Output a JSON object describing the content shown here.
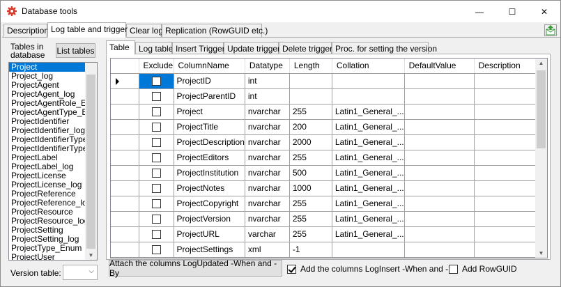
{
  "window": {
    "title": "Database tools",
    "controls": {
      "minimize": "—",
      "maximize": "☐",
      "close": "✕"
    }
  },
  "tabs": [
    {
      "label": "Description"
    },
    {
      "label": "Log table and trigger"
    },
    {
      "label": "Clear log"
    },
    {
      "label": "Replication (RowGUID etc.)"
    }
  ],
  "left": {
    "tables_label": "Tables in database",
    "list_tables_button": "List tables",
    "tables": [
      "Project",
      "Project_log",
      "ProjectAgent",
      "ProjectAgent_log",
      "ProjectAgentRole_Enum",
      "ProjectAgentType_Enum",
      "ProjectIdentifier",
      "ProjectIdentifier_log",
      "ProjectIdentifierType",
      "ProjectIdentifierType_log",
      "ProjectLabel",
      "ProjectLabel_log",
      "ProjectLicense",
      "ProjectLicense_log",
      "ProjectReference",
      "ProjectReference_log",
      "ProjectResource",
      "ProjectResource_log",
      "ProjectSetting",
      "ProjectSetting_log",
      "ProjectType_Enum",
      "ProjectUser"
    ],
    "selected_table": "Project",
    "version_table_label": "Version table:",
    "version_table_value": ""
  },
  "inner_tabs": [
    {
      "label": "Table"
    },
    {
      "label": "Log table"
    },
    {
      "label": "Insert Trigger"
    },
    {
      "label": "Update trigger"
    },
    {
      "label": "Delete trigger"
    },
    {
      "label": "Proc. for setting the version"
    }
  ],
  "grid": {
    "columns": [
      "Exclude",
      "ColumnName",
      "Datatype",
      "Length",
      "Collation",
      "DefaultValue",
      "Description"
    ],
    "rows": [
      {
        "exclude": false,
        "column_name": "ProjectID",
        "datatype": "int",
        "length": "",
        "collation": "",
        "default_value": "",
        "description": ""
      },
      {
        "exclude": false,
        "column_name": "ProjectParentID",
        "datatype": "int",
        "length": "",
        "collation": "",
        "default_value": "",
        "description": ""
      },
      {
        "exclude": false,
        "column_name": "Project",
        "datatype": "nvarchar",
        "length": "255",
        "collation": "Latin1_General_...",
        "default_value": "",
        "description": ""
      },
      {
        "exclude": false,
        "column_name": "ProjectTitle",
        "datatype": "nvarchar",
        "length": "200",
        "collation": "Latin1_General_...",
        "default_value": "",
        "description": ""
      },
      {
        "exclude": false,
        "column_name": "ProjectDescription",
        "datatype": "nvarchar",
        "length": "2000",
        "collation": "Latin1_General_...",
        "default_value": "",
        "description": ""
      },
      {
        "exclude": false,
        "column_name": "ProjectEditors",
        "datatype": "nvarchar",
        "length": "255",
        "collation": "Latin1_General_...",
        "default_value": "",
        "description": ""
      },
      {
        "exclude": false,
        "column_name": "ProjectInstitution",
        "datatype": "nvarchar",
        "length": "500",
        "collation": "Latin1_General_...",
        "default_value": "",
        "description": ""
      },
      {
        "exclude": false,
        "column_name": "ProjectNotes",
        "datatype": "nvarchar",
        "length": "1000",
        "collation": "Latin1_General_...",
        "default_value": "",
        "description": ""
      },
      {
        "exclude": false,
        "column_name": "ProjectCopyright",
        "datatype": "nvarchar",
        "length": "255",
        "collation": "Latin1_General_...",
        "default_value": "",
        "description": ""
      },
      {
        "exclude": false,
        "column_name": "ProjectVersion",
        "datatype": "nvarchar",
        "length": "255",
        "collation": "Latin1_General_...",
        "default_value": "",
        "description": ""
      },
      {
        "exclude": false,
        "column_name": "ProjectURL",
        "datatype": "varchar",
        "length": "255",
        "collation": "Latin1_General_...",
        "default_value": "",
        "description": ""
      },
      {
        "exclude": false,
        "column_name": "ProjectSettings",
        "datatype": "xml",
        "length": "-1",
        "collation": "",
        "default_value": "",
        "description": ""
      }
    ]
  },
  "bottom": {
    "attach_button": "Attach the columns LogUpdated -When and -By",
    "add_loginsert_label": "Add the columns LogInsert -When and -By",
    "add_loginsert_checked": true,
    "add_rowguid_label": "Add RowGUID",
    "add_rowguid_checked": false
  },
  "colors": {
    "selection": "#0078d7",
    "app_icon": "#d93a2b",
    "export_icon": "#3a9b3a"
  },
  "icons": {
    "app": "gear-icon",
    "export": "export-mail-icon",
    "row_pointer": "row-pointer-icon"
  }
}
